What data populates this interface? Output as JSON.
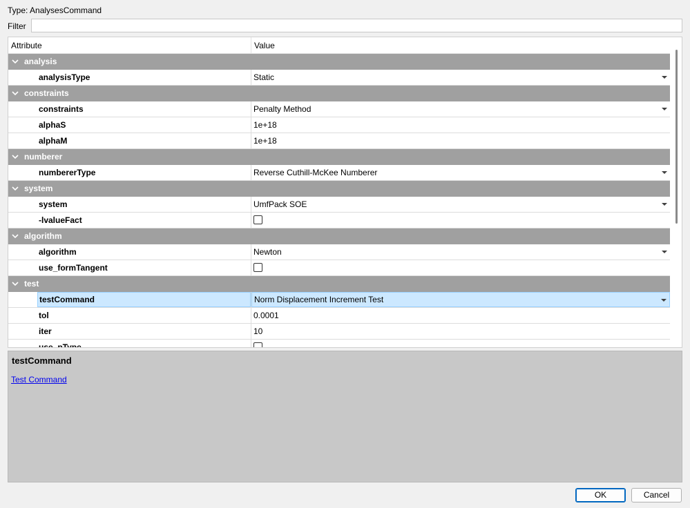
{
  "type_line": "Type: AnalysesCommand",
  "filter": {
    "label": "Filter",
    "value": "",
    "placeholder": ""
  },
  "columns": {
    "attribute": "Attribute",
    "value": "Value"
  },
  "groups": [
    {
      "label": "analysis",
      "items": [
        {
          "attr": "analysisType",
          "kind": "dropdown",
          "value": "Static"
        }
      ]
    },
    {
      "label": "constraints",
      "items": [
        {
          "attr": "constraints",
          "kind": "dropdown",
          "value": "Penalty Method"
        },
        {
          "attr": "alphaS",
          "kind": "text",
          "value": "1e+18"
        },
        {
          "attr": "alphaM",
          "kind": "text",
          "value": "1e+18"
        }
      ]
    },
    {
      "label": "numberer",
      "items": [
        {
          "attr": "numbererType",
          "kind": "dropdown",
          "value": "Reverse Cuthill-McKee Numberer"
        }
      ]
    },
    {
      "label": "system",
      "items": [
        {
          "attr": "system",
          "kind": "dropdown",
          "value": "UmfPack SOE"
        },
        {
          "attr": "-lvalueFact",
          "kind": "checkbox",
          "value": ""
        }
      ]
    },
    {
      "label": "algorithm",
      "items": [
        {
          "attr": "algorithm",
          "kind": "dropdown",
          "value": "Newton"
        },
        {
          "attr": "use_formTangent",
          "kind": "checkbox",
          "value": ""
        }
      ]
    },
    {
      "label": "test",
      "items": [
        {
          "attr": "testCommand",
          "kind": "dropdown",
          "value": "Norm Displacement Increment Test",
          "selected": true
        },
        {
          "attr": "tol",
          "kind": "text",
          "value": "0.0001"
        },
        {
          "attr": "iter",
          "kind": "text",
          "value": "10"
        },
        {
          "attr": "use_pType",
          "kind": "checkbox",
          "value": ""
        }
      ]
    }
  ],
  "help": {
    "title": "testCommand",
    "link": "Test Command"
  },
  "buttons": {
    "ok": "OK",
    "cancel": "Cancel"
  },
  "colors": {
    "group_bg": "#a0a0a0",
    "selection_bg": "#cce8ff",
    "selection_border": "#99d1ff",
    "help_bg": "#c8c8c8",
    "link": "#0000ee"
  }
}
